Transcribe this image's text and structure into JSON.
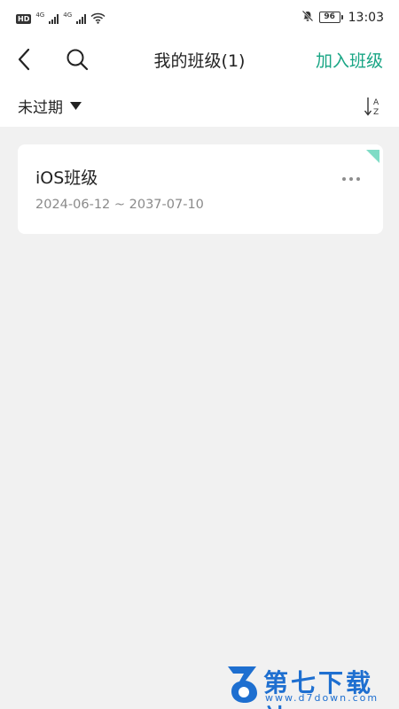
{
  "status_bar": {
    "hd_badge": "HD",
    "net_label_1": "4G",
    "net_label_2": "4G",
    "battery_level": "96",
    "time": "13:03"
  },
  "header": {
    "title": "我的班级(1)",
    "join_label": "加入班级"
  },
  "filter": {
    "selected": "未过期"
  },
  "classes": [
    {
      "name": "iOS班级",
      "dates": "2024-06-12 ~ 2037-07-10"
    }
  ],
  "watermark": {
    "title": "第七下载站",
    "url": "www.d7down.com"
  },
  "colors": {
    "accent": "#18a584",
    "corner_tag": "#7fdcc6",
    "background": "#f1f1f1",
    "watermark": "#1e6fd0"
  }
}
